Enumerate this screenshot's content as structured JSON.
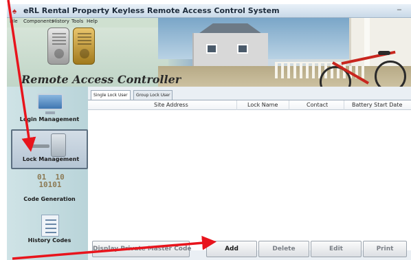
{
  "window": {
    "title": "eRL Rental Property Keyless Remote Access Control System",
    "minimize_glyph": "–"
  },
  "menu": {
    "items": [
      "File",
      "Components",
      "History",
      "Tools",
      "Help"
    ]
  },
  "header": {
    "logo_text": "Remote Access Controller"
  },
  "sidebar": {
    "items": [
      {
        "label": "Login Management",
        "icon": "monitor-icon",
        "selected": false
      },
      {
        "label": "Lock Management",
        "icon": "door-lock-icon",
        "selected": true
      },
      {
        "label": "Code Generation",
        "icon": "code-icon",
        "selected": false,
        "icon_text": "01  10\n10101"
      },
      {
        "label": "History Codes",
        "icon": "document-icon",
        "selected": false
      }
    ]
  },
  "tabs": [
    {
      "label": "Single Lock User",
      "active": true
    },
    {
      "label": "Group Lock User",
      "active": false
    }
  ],
  "table": {
    "columns": [
      "Site Address",
      "Lock Name",
      "Contact",
      "Battery Start Date"
    ],
    "rows": []
  },
  "buttons": {
    "private_master": "Display Private Master Code",
    "add": "Add",
    "delete": "Delete",
    "edit": "Edit",
    "print": "Print"
  },
  "annotation": {
    "arrow_color": "#e8141c"
  }
}
